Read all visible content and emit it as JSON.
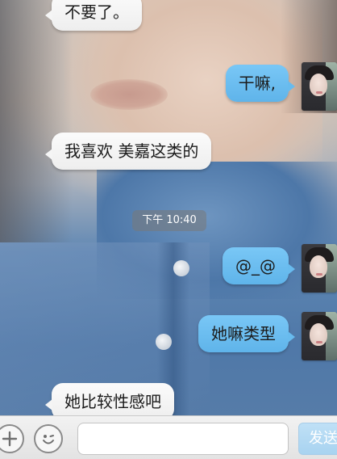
{
  "messages": [
    {
      "side": "incoming",
      "text": "不要了。"
    },
    {
      "side": "outgoing",
      "text": "干嘛,"
    },
    {
      "side": "incoming",
      "text": "我喜欢 美嘉这类的"
    },
    {
      "side": "outgoing",
      "text": "@_@"
    },
    {
      "side": "outgoing",
      "text": "她嘛类型"
    },
    {
      "side": "incoming",
      "text": "她比较性感吧"
    }
  ],
  "timestamp": "下午 10:40",
  "input": {
    "value": "",
    "placeholder": "",
    "send_label": "发送"
  },
  "icons": {
    "plus": "plus-icon",
    "emoji": "emoji-icon"
  },
  "colors": {
    "outgoing_bubble": "#6bbcf0",
    "incoming_bubble": "#f4f4f4",
    "timestamp_bg": "#8a8a8a"
  }
}
